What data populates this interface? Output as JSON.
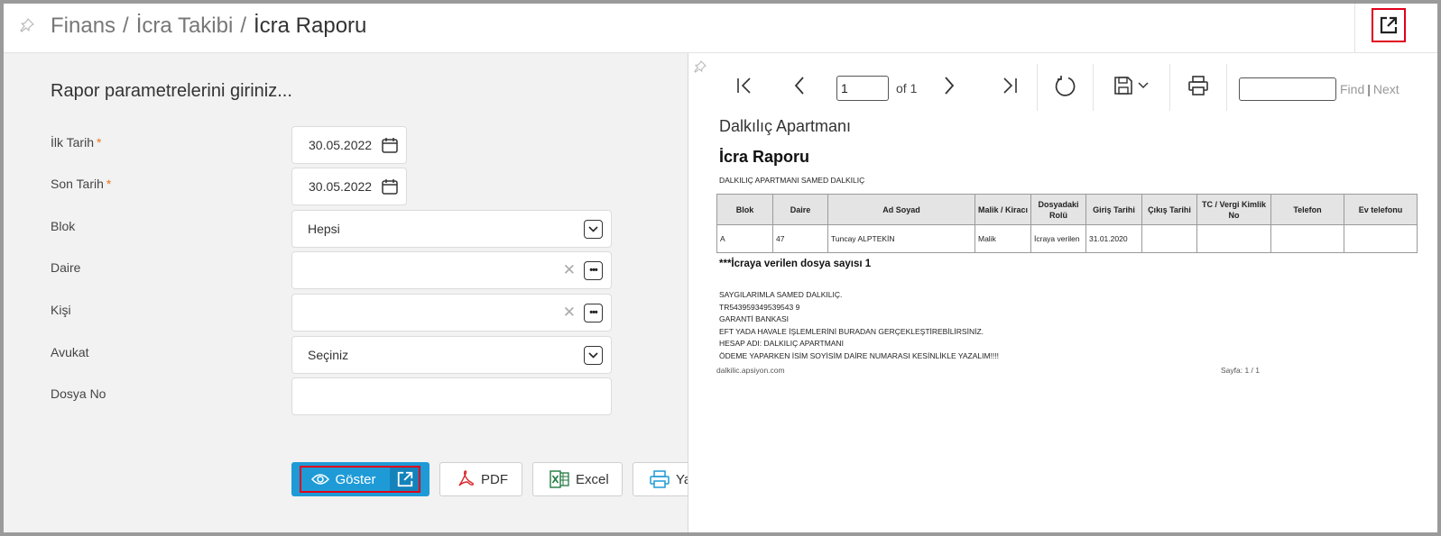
{
  "header": {
    "breadcrumb": [
      "Finans",
      "İcra Takibi",
      "İcra Raporu"
    ],
    "separator": "/"
  },
  "form": {
    "title": "Rapor parametrelerini giriniz...",
    "required_mark": "*",
    "fields": {
      "start_date": {
        "label": "İlk Tarih",
        "value": "30.05.2022"
      },
      "end_date": {
        "label": "Son Tarih",
        "value": "30.05.2022"
      },
      "block": {
        "label": "Blok",
        "value": "Hepsi"
      },
      "apartment": {
        "label": "Daire",
        "value": ""
      },
      "person": {
        "label": "Kişi",
        "value": ""
      },
      "lawyer": {
        "label": "Avukat",
        "value": "Seçiniz"
      },
      "file_no": {
        "label": "Dosya No",
        "value": ""
      }
    }
  },
  "buttons": {
    "show": "Göster",
    "pdf": "PDF",
    "excel": "Excel",
    "print_partial": "Ya"
  },
  "viewer": {
    "page_value": "1",
    "page_of": "of 1",
    "find": "Find",
    "find_sep": "|",
    "next": "Next"
  },
  "report": {
    "company": "Dalkılıç Apartmanı",
    "title": "İcra Raporu",
    "subtitle": "DALKILIÇ APARTMANI SAMED DALKILIÇ",
    "columns": [
      "Blok",
      "Daire",
      "Ad Soyad",
      "Malik / Kiracı",
      "Dosyadaki Rolü",
      "Giriş Tarihi",
      "Çıkış Tarihi",
      "TC / Vergi Kimlik No",
      "Telefon",
      "Ev telefonu"
    ],
    "rows": [
      [
        "A",
        "47",
        "Tuncay ALPTEKİN",
        "Malik",
        "İcraya verilen",
        "31.01.2020",
        "",
        "",
        "",
        ""
      ]
    ],
    "count_text": "***İcraya verilen dosya sayısı 1",
    "notes": [
      "SAYGILARIMLA SAMED DALKILIÇ.",
      "TR543959349539543 9",
      "GARANTİ BANKASI",
      "EFT YADA HAVALE İŞLEMLERİNİ BURADAN GERÇEKLEŞTİREBİLİRSİNİZ.",
      "HESAP ADI: DALKILIÇ APARTMANI",
      "ÖDEME YAPARKEN İSİM SOYİSİM DAİRE NUMARASI KESİNLİKLE YAZALIM!!!!"
    ],
    "footer_left": "dalkilic.apsiyon.com",
    "footer_right": "Sayfa: 1 / 1"
  },
  "colors": {
    "accent": "#1e9bd7",
    "highlight": "#e0001b",
    "required": "#e87722"
  },
  "icons": [
    "pin-icon",
    "popout-icon",
    "calendar-icon",
    "chevron-down-icon",
    "clear-icon",
    "ellipsis-icon",
    "eye-icon",
    "pdf-icon",
    "excel-icon",
    "printer-icon",
    "first-page-icon",
    "prev-page-icon",
    "next-page-icon",
    "last-page-icon",
    "refresh-icon",
    "save-icon"
  ]
}
